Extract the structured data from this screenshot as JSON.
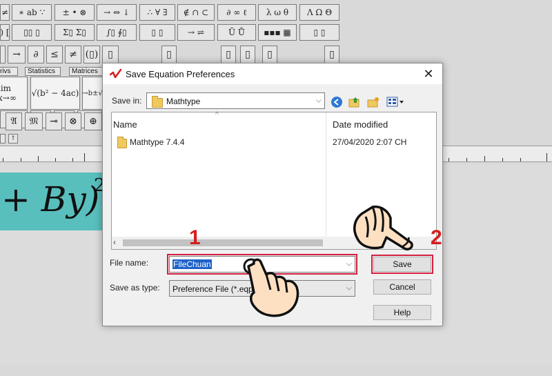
{
  "toolbar": {
    "row1": [
      "≤ ≠ ≈",
      "∗ ab ∵",
      "± • ⊗",
      "→ ⇔ ↓",
      "∴ ∀ ∃",
      "∉ ∩ ⊂",
      "∂ ∞ ℓ",
      "λ ω θ",
      "Λ Ω Θ"
    ],
    "row2": [
      "(▯) [▯]",
      "▯▯ ▯",
      "Σ▯ Σ▯",
      "∫▯ ∮▯",
      "▯ ▯",
      "→ ⇌",
      "Ū Ů",
      "▪▪▪ ▦",
      "▯ ▯"
    ],
    "row3": [
      "→",
      "∂",
      "≤",
      "≠",
      "(▯)",
      "▯",
      "▯",
      "▯",
      "▯",
      "▯",
      "▯"
    ],
    "row4": [
      "𝔄",
      "𝔐",
      "⊸",
      "⊗",
      "⊕"
    ],
    "tabs": [
      "rivs",
      "Statistics",
      "Matrices"
    ],
    "templates": [
      "lim x→∞",
      "√(b² − 4ac)",
      "→b±√"
    ]
  },
  "equation": {
    "text": "+ By)",
    "exponent": "2"
  },
  "dialog": {
    "title": "Save Equation Preferences",
    "close_label": "✕",
    "save_in_label": "Save in:",
    "save_in_value": "Mathtype",
    "columns": {
      "name": "Name",
      "date": "Date modified"
    },
    "files": [
      {
        "name": "Mathtype 7.4.4",
        "date": "27/04/2020 2:07 CH"
      }
    ],
    "file_name_label": "File name:",
    "file_name_value": "FileChuan",
    "save_as_type_label": "Save as type:",
    "save_as_type_value": "Preference File (*.eqp)",
    "buttons": {
      "save": "Save",
      "cancel": "Cancel",
      "help": "Help"
    }
  },
  "annotations": {
    "step1": "1",
    "step2": "2"
  },
  "colors": {
    "highlight": "#d41f3f",
    "selection": "#1d62c9",
    "equation_bg": "#58bfbd",
    "hand_fill": "#fde0c2"
  }
}
